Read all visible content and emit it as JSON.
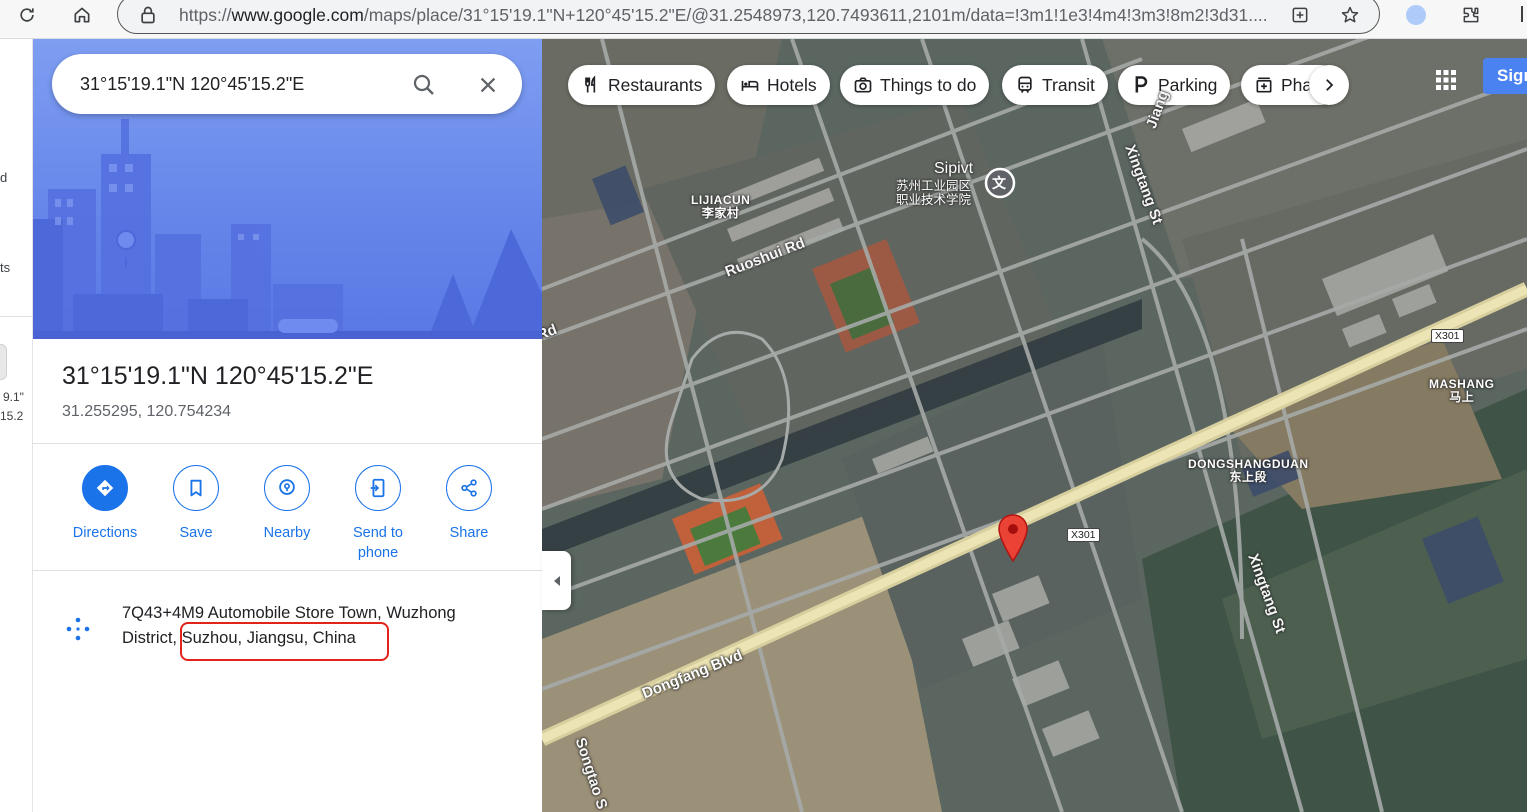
{
  "browser": {
    "url_prefix": "https://",
    "url_host": "www.google.com",
    "url_rest": "/maps/place/31°15'19.1\"N+120°45'15.2\"E/@31.2548973,120.7493611,2101m/data=!3m1!1e3!4m4!3m3!8m2!3d31...."
  },
  "rail": {
    "text1": "d",
    "text2": "ts",
    "text3": "9.1\"",
    "text4": "15.2"
  },
  "search": {
    "value": "31°15'19.1\"N 120°45'15.2\"E"
  },
  "place": {
    "title": "31°15'19.1\"N 120°45'15.2\"E",
    "decimal_coords": "31.255295, 120.754234"
  },
  "actions": [
    {
      "label": "Directions"
    },
    {
      "label": "Save"
    },
    {
      "label": "Nearby"
    },
    {
      "label": "Send to phone"
    },
    {
      "label": "Share"
    }
  ],
  "address": {
    "text": "7Q43+4M9 Automobile Store Town, Wuzhong District, Suzhou, Jiangsu, China"
  },
  "chips": [
    {
      "label": "Restaurants",
      "icon": "fork-knife-icon"
    },
    {
      "label": "Hotels",
      "icon": "bed-icon"
    },
    {
      "label": "Things to do",
      "icon": "camera-icon"
    },
    {
      "label": "Transit",
      "icon": "train-icon"
    },
    {
      "label": "Parking",
      "icon": "parking-icon"
    },
    {
      "label": "Pha",
      "icon": "pharmacy-icon"
    }
  ],
  "header": {
    "signin_label": "Sign"
  },
  "map": {
    "labels": {
      "school_en": "Sipivt",
      "school_cn_1": "苏州工业园区",
      "school_cn_2": "职业技术学院",
      "lijiacun_en": "LIJIACUN",
      "lijiacun_cn": "李家村",
      "ruoshui": "Ruoshui Rd",
      "rd_fragment": "Rd",
      "jiang_fragment": "Jiang",
      "xingtang_top": "Xingtang St",
      "xingtang_bottom": "Xingtang St",
      "mashang_en": "MASHANG",
      "mashang_cn": "马上",
      "dongshangduan_en": "DONGSHANGDUAN",
      "dongshangduan_cn": "东上段",
      "x301_a": "X301",
      "x301_b": "X301",
      "dongfang": "Dongfang Blvd",
      "songtao": "Songtao S"
    }
  },
  "colors": {
    "accent": "#1a73e8",
    "pin": "#ea4335",
    "hero": "#6585ea",
    "annotation": "#e2231a"
  }
}
